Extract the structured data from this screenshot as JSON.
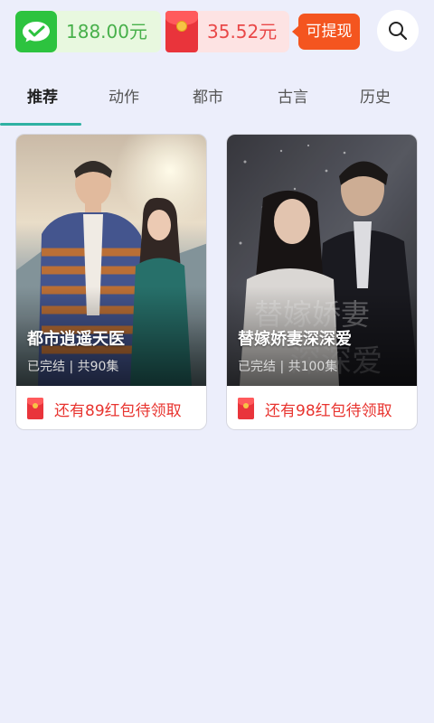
{
  "wallet": {
    "wechat_balance": "188.00元",
    "redpacket_balance": "35.52元",
    "withdraw_label": "可提现"
  },
  "tabs": [
    {
      "label": "推荐",
      "active": true
    },
    {
      "label": "动作",
      "active": false
    },
    {
      "label": "都市",
      "active": false
    },
    {
      "label": "古言",
      "active": false
    },
    {
      "label": "历史",
      "active": false
    }
  ],
  "dramas": [
    {
      "title": "都市逍遥天医",
      "status": "已完结 | 共90集",
      "reward": "还有89红包待领取"
    },
    {
      "title": "替嫁娇妻深深爱",
      "status": "已完结 | 共100集",
      "reward": "还有98红包待领取"
    }
  ],
  "colors": {
    "accent_tab": "#2fb1a3",
    "withdraw": "#f4551f",
    "reward_text": "#e8342f",
    "wechat_green": "#2dc33f"
  },
  "icons": {
    "wallet": "wechat-pay-icon",
    "redpacket": "red-envelope-icon",
    "search": "search-icon"
  }
}
